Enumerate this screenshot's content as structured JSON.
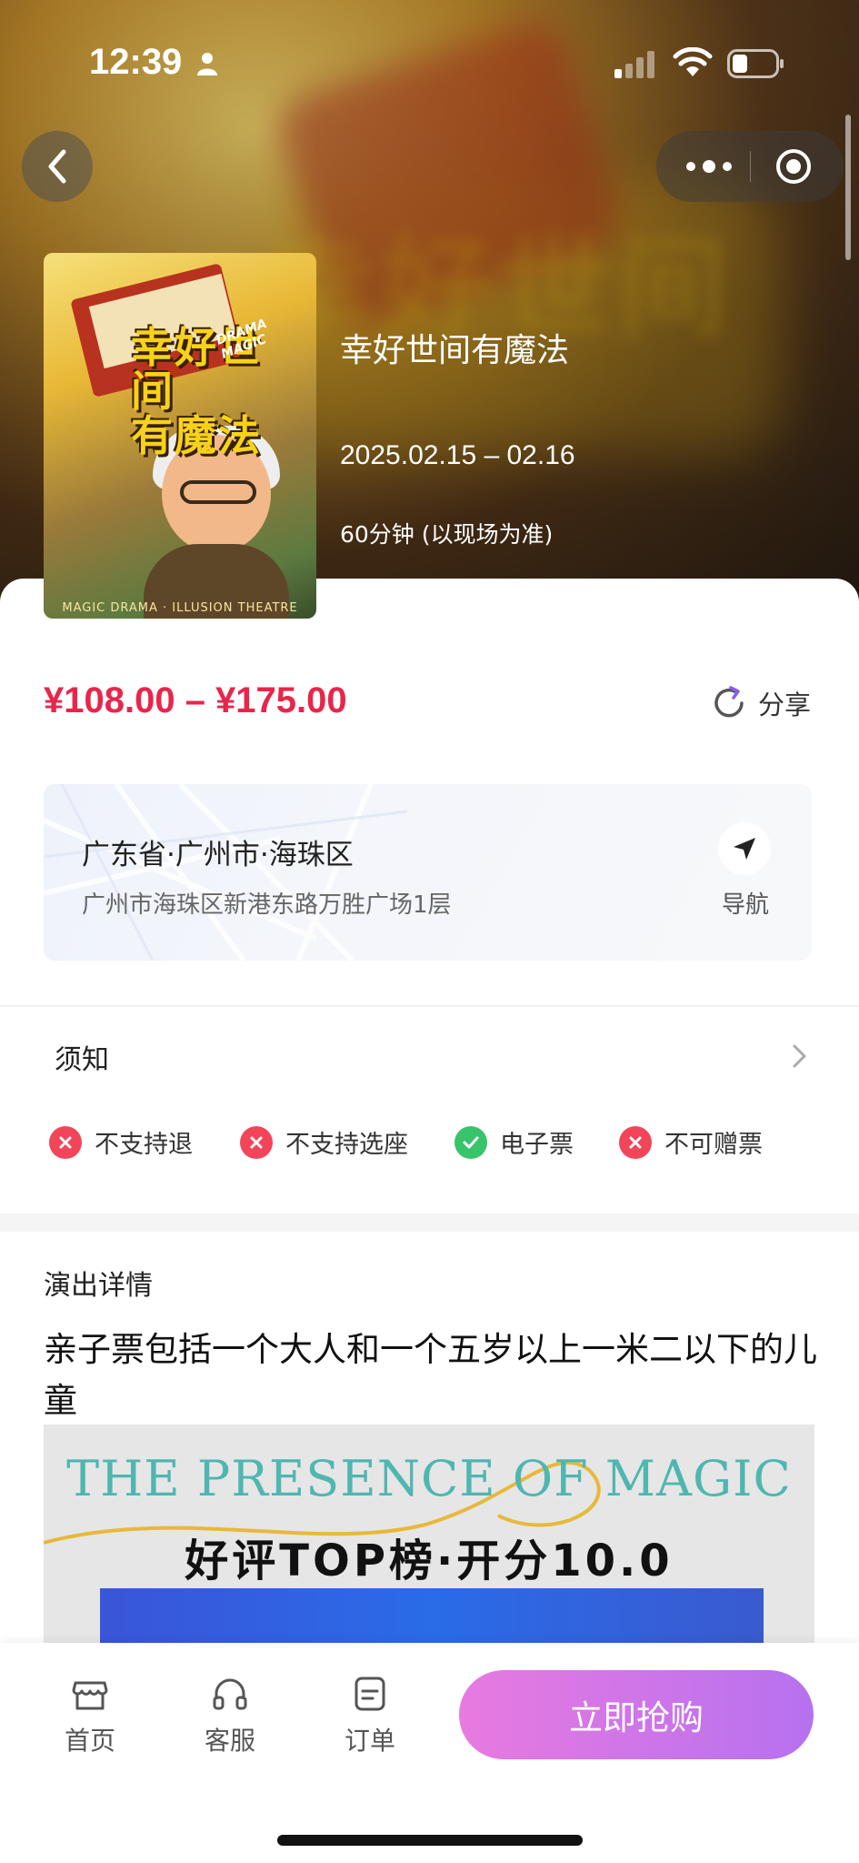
{
  "status_bar": {
    "time": "12:39"
  },
  "show": {
    "title": "幸好世间有魔法",
    "dates": "2025.02.15 – 02.16",
    "duration": "60分钟 (以现场为准)",
    "poster": {
      "title_line1": "幸好世间",
      "title_line2": "有魔法",
      "tag": "DRAMA MAGIC",
      "footer": "MAGIC DRAMA · ILLUSION THEATRE"
    }
  },
  "price": {
    "range": "¥108.00 – ¥175.00"
  },
  "share": {
    "label": "分享"
  },
  "venue": {
    "city": "广东省·广州市·海珠区",
    "address": "广州市海珠区新港东路万胜广场1层",
    "nav_label": "导航"
  },
  "notice": {
    "label": "须知"
  },
  "policies": [
    {
      "label": "不支持退",
      "status": "no"
    },
    {
      "label": "不支持选座",
      "status": "no"
    },
    {
      "label": "电子票",
      "status": "yes"
    },
    {
      "label": "不可赠票",
      "status": "no"
    }
  ],
  "details": {
    "heading": "演出详情",
    "description": "亲子票包括一个大人和一个五岁以上一米二以下的儿童",
    "banner_line1": "THE PRESENCE OF MAGIC",
    "banner_line2": "好评TOP榜·开分10.0"
  },
  "bottom_nav": {
    "tabs": [
      {
        "label": "首页",
        "icon": "store-icon"
      },
      {
        "label": "客服",
        "icon": "headset-icon"
      },
      {
        "label": "订单",
        "icon": "order-icon"
      }
    ],
    "buy_label": "立即抢购"
  },
  "colors": {
    "price": "#e8264b",
    "buy_gradient_start": "#e87ae0",
    "buy_gradient_end": "#b671ef",
    "policy_no": "#f2455a",
    "policy_yes": "#38c46a"
  }
}
